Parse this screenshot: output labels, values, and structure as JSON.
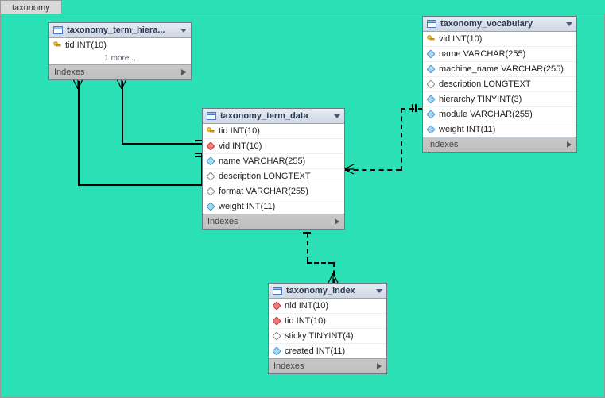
{
  "tab_label": "taxonomy",
  "tables": {
    "hier": {
      "title": "taxonomy_term_hiera...",
      "columns": {
        "tid": "tid INT(10)"
      },
      "more": "1 more...",
      "footer": "Indexes"
    },
    "data": {
      "title": "taxonomy_term_data",
      "columns": {
        "tid": "tid INT(10)",
        "vid": "vid INT(10)",
        "name": "name VARCHAR(255)",
        "description": "description LONGTEXT",
        "format": "format VARCHAR(255)",
        "weight": "weight INT(11)"
      },
      "footer": "Indexes"
    },
    "vocab": {
      "title": "taxonomy_vocabulary",
      "columns": {
        "vid": "vid INT(10)",
        "name": "name VARCHAR(255)",
        "machine_name": "machine_name VARCHAR(255)",
        "description": "description LONGTEXT",
        "hierarchy": "hierarchy TINYINT(3)",
        "module": "module VARCHAR(255)",
        "weight": "weight INT(11)"
      },
      "footer": "Indexes"
    },
    "index": {
      "title": "taxonomy_index",
      "columns": {
        "nid": "nid INT(10)",
        "tid": "tid INT(10)",
        "sticky": "sticky TINYINT(4)",
        "created": "created INT(11)"
      },
      "footer": "Indexes"
    }
  }
}
